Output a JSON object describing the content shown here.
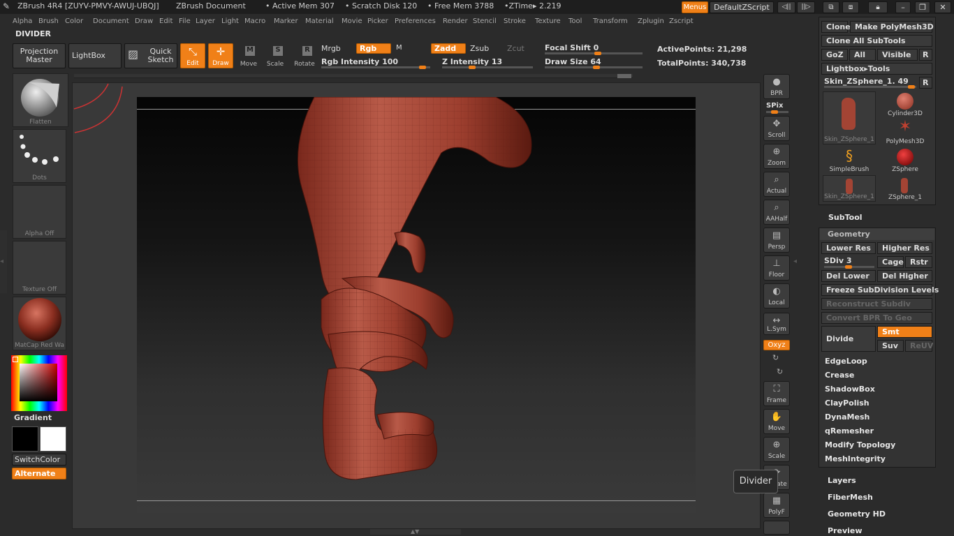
{
  "title": {
    "app": "ZBrush 4R4 [ZUYV-PMVY-AWUJ-UBQJ]",
    "doc": "ZBrush Document",
    "active_mem": "• Active Mem 307",
    "scratch": "• Scratch Disk 120",
    "free_mem": "• Free Mem 3788",
    "ztime": "•ZTime▸ 2.219",
    "menus": "Menus",
    "zscript": "DefaultZScript"
  },
  "menu": [
    "Alpha",
    "Brush",
    "Color",
    "Document",
    "Draw",
    "Edit",
    "File",
    "Layer",
    "Light",
    "Macro",
    "Marker",
    "Material",
    "Movie",
    "Picker",
    "Preferences",
    "Render",
    "Stencil",
    "Stroke",
    "Texture",
    "Tool",
    "Transform",
    "Zplugin",
    "Zscript"
  ],
  "divider_label": "DIVIDER",
  "toolbar": {
    "projection_master": "Projection Master",
    "lightbox": "LightBox",
    "quick_sketch": "Quick Sketch",
    "edit": "Edit",
    "draw": "Draw",
    "move": "Move",
    "scale": "Scale",
    "rotate": "Rotate",
    "mrgb": "Mrgb",
    "rgb": "Rgb",
    "m": "M",
    "zadd": "Zadd",
    "zsub": "Zsub",
    "zcut": "Zcut",
    "rgb_intensity": "Rgb Intensity 100",
    "z_intensity": "Z Intensity 13",
    "focal_shift": "Focal Shift 0",
    "draw_size": "Draw Size 64",
    "active_points": "ActivePoints: 21,298",
    "total_points": "TotalPoints: 340,738"
  },
  "left": {
    "flatten": "Flatten",
    "dots": "Dots",
    "alpha": "Alpha Off",
    "texture": "Texture Off",
    "material": "MatCap Red Wa",
    "gradient": "Gradient",
    "switch_color": "SwitchColor",
    "alternate": "Alternate"
  },
  "right_shelf": {
    "bpr": "BPR",
    "spix": "SPix",
    "scroll": "Scroll",
    "zoom": "Zoom",
    "actual": "Actual",
    "aahalf": "AAHalf",
    "persp": "Persp",
    "floor": "Floor",
    "local": "Local",
    "lsym": "L.Sym",
    "xyz": "Oxyz",
    "frame": "Frame",
    "move": "Move",
    "scale": "Scale",
    "rotate": "Rotate",
    "polyf": "PolyF"
  },
  "tool_panel": {
    "clone": "Clone",
    "make_polymesh": "Make PolyMesh3D",
    "clone_all": "Clone All SubTools",
    "goz": "GoZ",
    "all": "All",
    "visible": "Visible",
    "r": "R",
    "lightbox_tools": "Lightbox▸Tools",
    "skin_slider": "Skin_ZSphere_1. 49",
    "items": [
      "Skin_ZSphere_1",
      "Cylinder3D",
      "PolyMesh3D",
      "SimpleBrush",
      "ZSphere",
      "Skin_ZSphere_1",
      "ZSphere_1"
    ],
    "subtool": "SubTool",
    "geometry": "Geometry",
    "lower_res": "Lower Res",
    "higher_res": "Higher Res",
    "sdiv": "SDiv 3",
    "cage": "Cage",
    "rstr": "Rstr",
    "del_lower": "Del Lower",
    "del_higher": "Del Higher",
    "freeze": "Freeze SubDivision Levels",
    "reconstruct": "Reconstruct Subdiv",
    "convert_bpr": "Convert BPR To Geo",
    "divide": "Divide",
    "smt": "Smt",
    "suv": "Suv",
    "reuv": "ReUV",
    "sections": [
      "EdgeLoop",
      "Crease",
      "ShadowBox",
      "ClayPolish",
      "DynaMesh",
      "qRemesher",
      "Modify Topology",
      "MeshIntegrity"
    ],
    "below": [
      "Layers",
      "FiberMesh",
      "Geometry HD",
      "Preview"
    ]
  },
  "tooltip": "Divider",
  "colors": {
    "accent": "#f08018",
    "model": "#a34434"
  }
}
